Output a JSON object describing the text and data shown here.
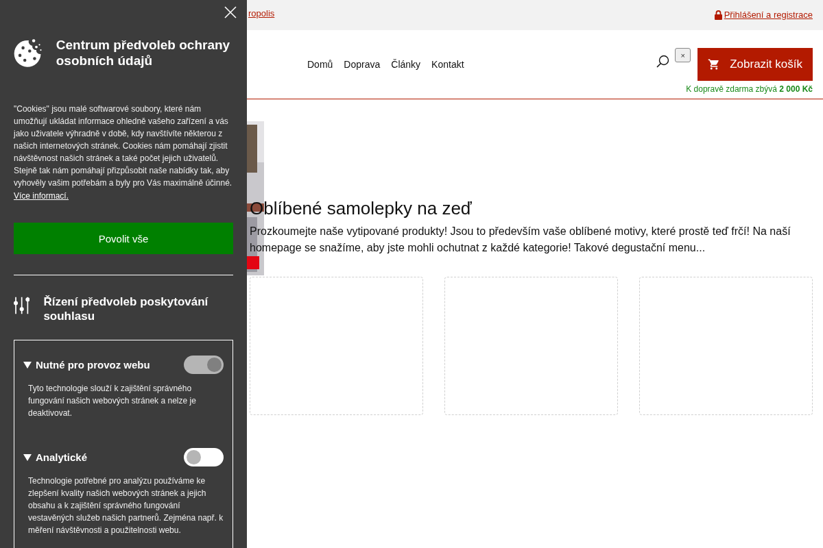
{
  "top_bar": {
    "partial_link": "ropolis",
    "login_link": "Přihlášení a registrace"
  },
  "header": {
    "nav": [
      "Domů",
      "Doprava",
      "Články",
      "Kontakt"
    ],
    "close_button": "×",
    "cart_button": "Zobrazit košík",
    "free_shipping": "K dopravě zdarma zbývá **2 000 Kč**"
  },
  "main": {
    "heading": "Oblíbené samolepky na zeď",
    "intro": "Prozkoumejte naše vytipované produkty! Jsou to především vaše oblíbené motivy, které prostě teď frčí! Na naší homepage se snažíme, aby jste mohli ochutnat z každé kategorie! Takové degustační menu...",
    "cards": [
      {
        "kind": "empty"
      },
      {
        "kind": "empty"
      },
      {
        "kind": "empty"
      }
    ]
  },
  "cookie_panel": {
    "title": "Centrum předvoleb ochrany osobních údajů",
    "description": "\"Cookies\" jsou malé softwarové soubory, které nám umožňují ukládat informace ohledně vašeho zařízení a vás jako uživatele výhradně v době, kdy navštívíte některou z našich internetových stránek. Cookies nám pomáhají zjistit návštěvnost našich stránek a také počet jejich uživatelů. Stejně tak nám pomáhají přizpůsobit naše nabídky tak, aby vyhověly vašim potřebám a byly pro Vás maximálně účinné.",
    "more_link": "Více informací.",
    "allow_all_button": "Povolit vše",
    "preferences_heading": "Řízení předvoleb poskytování souhlasu",
    "categories": [
      {
        "name": "Nutné pro provoz webu",
        "expanded": true,
        "on": true,
        "locked": true,
        "description": "Tyto technologie slouží k zajištění správného fungování našich webových stránek a nelze je deaktivovat."
      },
      {
        "name": "Analytické",
        "expanded": true,
        "on": false,
        "locked": false,
        "description": "Technologie potřebné pro analýzu používáme ke zlepšení kvality našich webových stránek a jejich obsahu a k zajištění správného fungování vestavěných služeb našich partnerů. Zejména např. k měření návštěvnosti a použitelnosti webu."
      }
    ]
  }
}
